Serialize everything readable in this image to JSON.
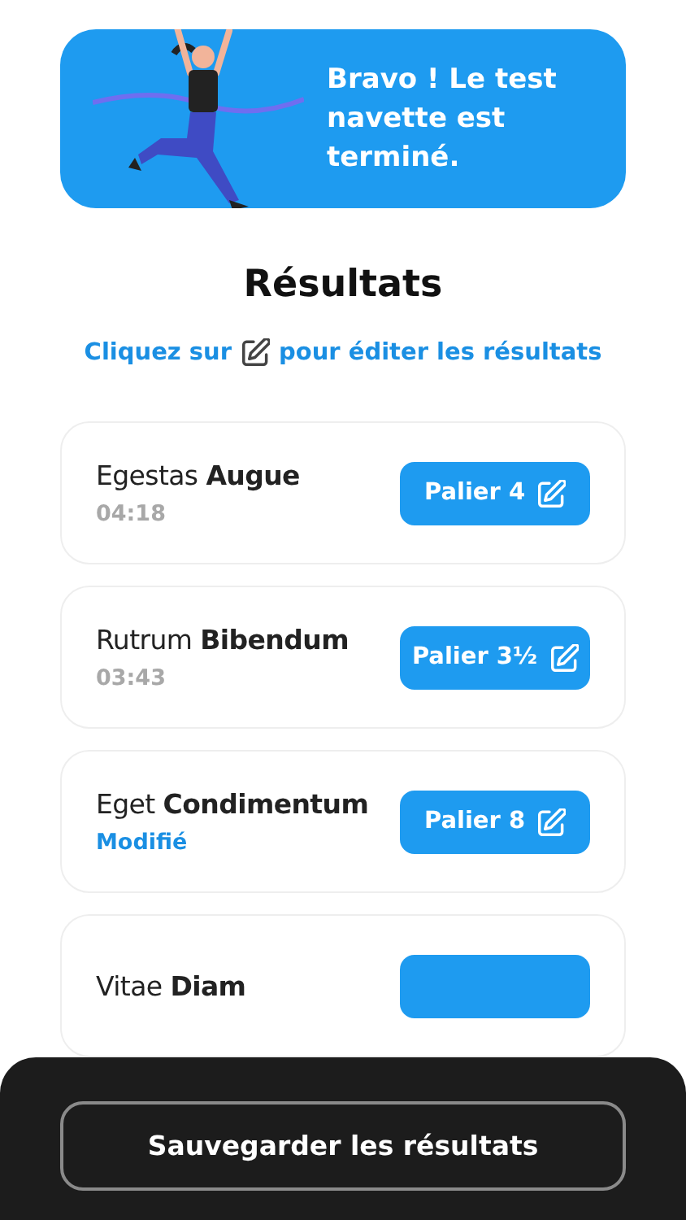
{
  "banner": {
    "message": "Bravo ! Le test navette est terminé."
  },
  "title": "Résultats",
  "hint": {
    "before": "Cliquez sur",
    "after": "pour éditer les résultats"
  },
  "results": [
    {
      "first": "Egestas",
      "last": "Augue",
      "status": "04:18",
      "kind": "time",
      "level_label": "Palier 4"
    },
    {
      "first": "Rutrum",
      "last": "Bibendum",
      "status": "03:43",
      "kind": "time",
      "level_label": "Palier 3½"
    },
    {
      "first": "Eget",
      "last": "Condimentum",
      "status": "Modifié",
      "kind": "modified",
      "level_label": "Palier 8"
    },
    {
      "first": "Vitae",
      "last": "Diam"
    }
  ],
  "save_button": "Sauvegarder les résultats"
}
